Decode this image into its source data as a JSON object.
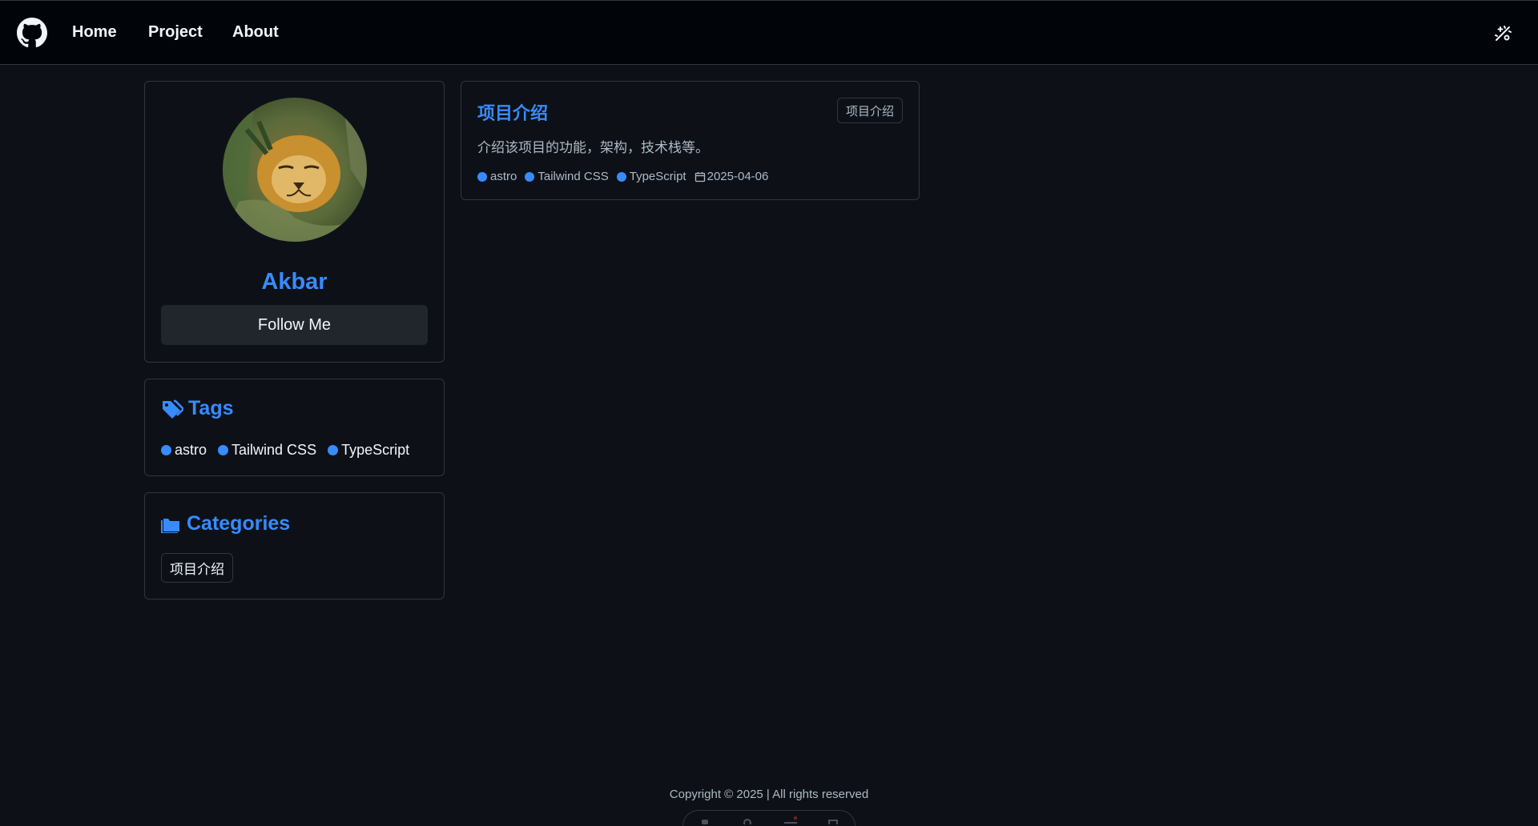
{
  "nav": {
    "links": [
      {
        "label": "Home"
      },
      {
        "label": "Project"
      },
      {
        "label": "About"
      }
    ]
  },
  "profile": {
    "name": "Akbar",
    "follow_label": "Follow Me"
  },
  "tags_card": {
    "title": "Tags",
    "tags": [
      "astro",
      "Tailwind CSS",
      "TypeScript"
    ]
  },
  "categories_card": {
    "title": "Categories",
    "items": [
      "项目介绍"
    ]
  },
  "post": {
    "title": "项目介绍",
    "category_badge": "项目介绍",
    "description": "介绍该项目的功能，架构，技术栈等。",
    "tags": [
      "astro",
      "Tailwind CSS",
      "TypeScript"
    ],
    "date": "2025-04-06"
  },
  "footer": {
    "copyright": "Copyright © 2025 | All rights reserved"
  },
  "icons": {
    "logo": "github-icon",
    "theme": "theme-toggle-icon",
    "tags": "tags-icon",
    "categories": "folder-icon",
    "date": "calendar-icon"
  },
  "colors": {
    "accent": "#388bfd",
    "background": "#0d1117",
    "navbar": "#010409",
    "border": "#30363d"
  }
}
